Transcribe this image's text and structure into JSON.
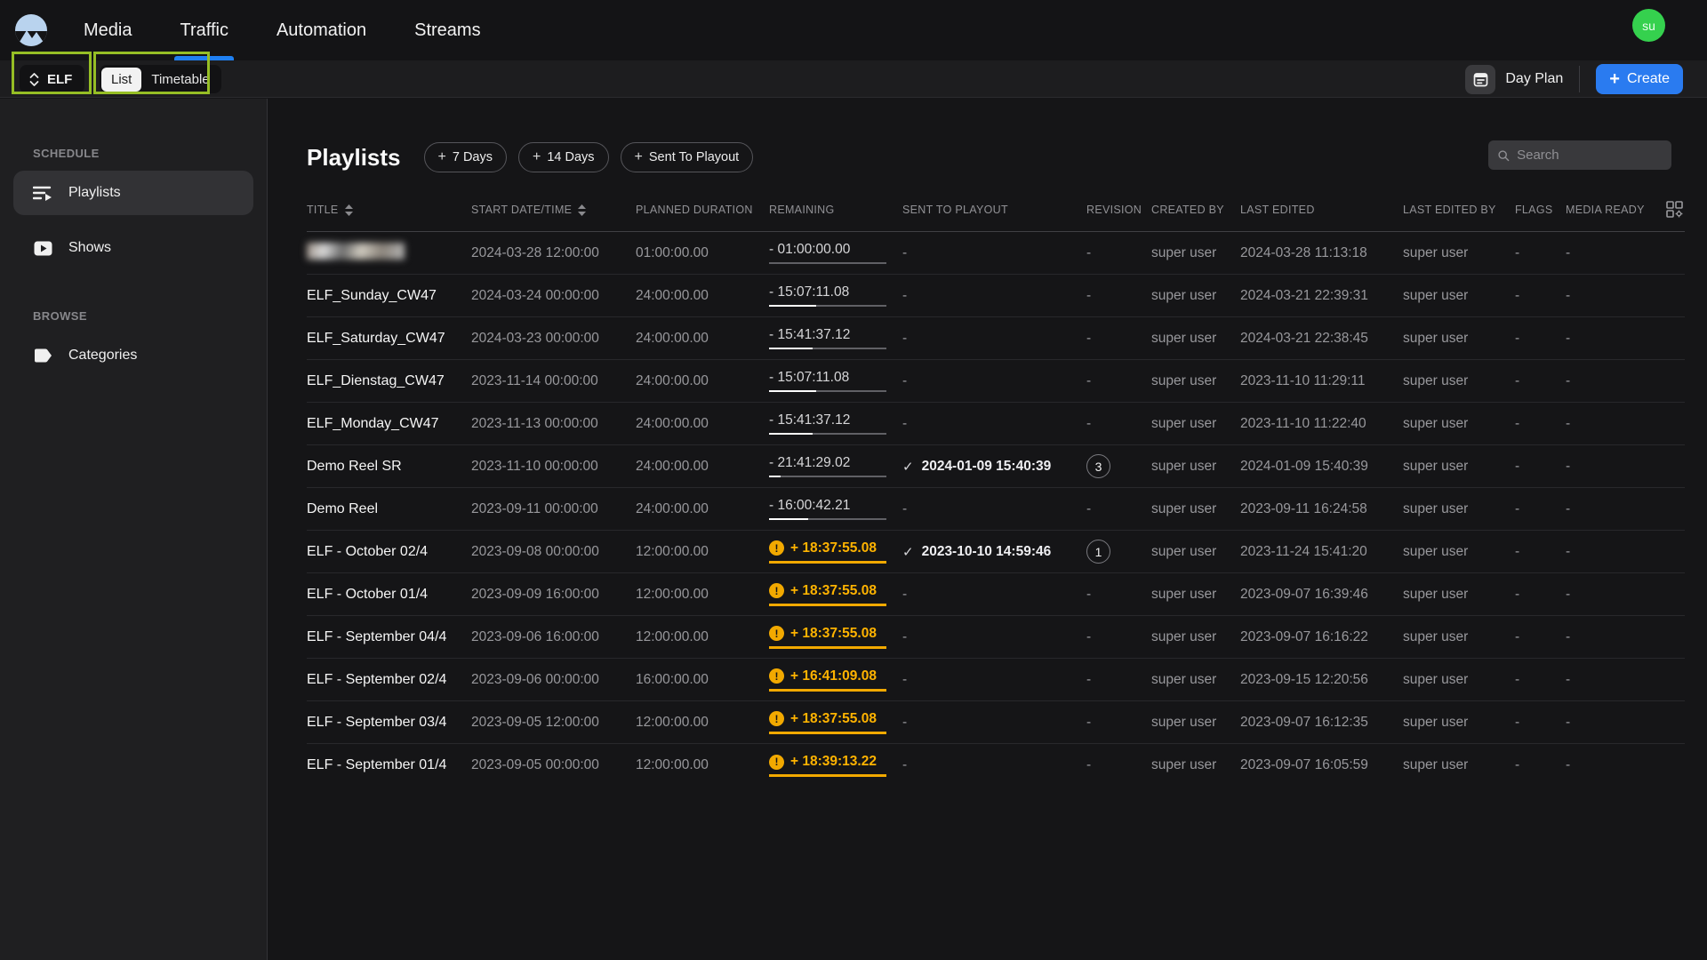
{
  "nav": {
    "items": [
      {
        "label": "Media"
      },
      {
        "label": "Traffic"
      },
      {
        "label": "Automation"
      },
      {
        "label": "Streams"
      }
    ],
    "active": "Traffic",
    "avatar_initials": "su"
  },
  "toolbar": {
    "channel_select": {
      "value": "ELF"
    },
    "view_toggle": {
      "options": [
        "List",
        "Timetable"
      ],
      "active": "List"
    },
    "day_plan_label": "Day Plan",
    "create_label": "Create"
  },
  "sidebar": {
    "schedule_label": "SCHEDULE",
    "browse_label": "BROWSE",
    "playlists_label": "Playlists",
    "shows_label": "Shows",
    "categories_label": "Categories",
    "active_item": "Playlists"
  },
  "main": {
    "title": "Playlists",
    "filters": [
      {
        "label": "7 Days"
      },
      {
        "label": "14 Days"
      },
      {
        "label": "Sent To Playout"
      }
    ],
    "search": {
      "placeholder": "Search",
      "value": ""
    }
  },
  "table": {
    "columns": [
      {
        "label": "TITLE",
        "sortable": true
      },
      {
        "label": "START DATE/TIME",
        "sortable": true
      },
      {
        "label": "PLANNED DURATION",
        "sortable": false
      },
      {
        "label": "REMAINING",
        "sortable": false
      },
      {
        "label": "SENT TO PLAYOUT",
        "sortable": false
      },
      {
        "label": "REVISION",
        "sortable": false
      },
      {
        "label": "CREATED BY",
        "sortable": false
      },
      {
        "label": "LAST EDITED",
        "sortable": false
      },
      {
        "label": "LAST EDITED BY",
        "sortable": false
      },
      {
        "label": "FLAGS",
        "sortable": false
      },
      {
        "label": "MEDIA READY",
        "sortable": false
      }
    ],
    "rows": [
      {
        "title": "",
        "redacted": true,
        "start": "2024-03-28 12:00:00",
        "duration": "01:00:00.00",
        "remaining": {
          "sign": "-",
          "time": "01:00:00.00",
          "warn": false,
          "progress": 0
        },
        "sent": null,
        "revision": null,
        "created_by": "super user",
        "last_edited": "2024-03-28 11:13:18",
        "last_edited_by": "super user",
        "flags": "-",
        "media_ready": "-"
      },
      {
        "title": "ELF_Sunday_CW47",
        "redacted": false,
        "start": "2024-03-24 00:00:00",
        "duration": "24:00:00.00",
        "remaining": {
          "sign": "-",
          "time": "15:07:11.08",
          "warn": false,
          "progress": 40
        },
        "sent": null,
        "revision": null,
        "created_by": "super user",
        "last_edited": "2024-03-21 22:39:31",
        "last_edited_by": "super user",
        "flags": "-",
        "media_ready": "-"
      },
      {
        "title": "ELF_Saturday_CW47",
        "redacted": false,
        "start": "2024-03-23 00:00:00",
        "duration": "24:00:00.00",
        "remaining": {
          "sign": "-",
          "time": "15:41:37.12",
          "warn": false,
          "progress": 37
        },
        "sent": null,
        "revision": null,
        "created_by": "super user",
        "last_edited": "2024-03-21 22:38:45",
        "last_edited_by": "super user",
        "flags": "-",
        "media_ready": "-"
      },
      {
        "title": "ELF_Dienstag_CW47",
        "redacted": false,
        "start": "2023-11-14 00:00:00",
        "duration": "24:00:00.00",
        "remaining": {
          "sign": "-",
          "time": "15:07:11.08",
          "warn": false,
          "progress": 40
        },
        "sent": null,
        "revision": null,
        "created_by": "super user",
        "last_edited": "2023-11-10 11:29:11",
        "last_edited_by": "super user",
        "flags": "-",
        "media_ready": "-"
      },
      {
        "title": "ELF_Monday_CW47",
        "redacted": false,
        "start": "2023-11-13 00:00:00",
        "duration": "24:00:00.00",
        "remaining": {
          "sign": "-",
          "time": "15:41:37.12",
          "warn": false,
          "progress": 37
        },
        "sent": null,
        "revision": null,
        "created_by": "super user",
        "last_edited": "2023-11-10 11:22:40",
        "last_edited_by": "super user",
        "flags": "-",
        "media_ready": "-"
      },
      {
        "title": "Demo Reel SR",
        "redacted": false,
        "start": "2023-11-10 00:00:00",
        "duration": "24:00:00.00",
        "remaining": {
          "sign": "-",
          "time": "21:41:29.02",
          "warn": false,
          "progress": 10
        },
        "sent": "2024-01-09 15:40:39",
        "revision": "3",
        "created_by": "super user",
        "last_edited": "2024-01-09 15:40:39",
        "last_edited_by": "super user",
        "flags": "-",
        "media_ready": "-"
      },
      {
        "title": "Demo Reel",
        "redacted": false,
        "start": "2023-09-11 00:00:00",
        "duration": "24:00:00.00",
        "remaining": {
          "sign": "-",
          "time": "16:00:42.21",
          "warn": false,
          "progress": 33
        },
        "sent": null,
        "revision": null,
        "created_by": "super user",
        "last_edited": "2023-09-11 16:24:58",
        "last_edited_by": "super user",
        "flags": "-",
        "media_ready": "-"
      },
      {
        "title": "ELF - October 02/4",
        "redacted": false,
        "start": "2023-09-08 00:00:00",
        "duration": "12:00:00.00",
        "remaining": {
          "sign": "+",
          "time": "18:37:55.08",
          "warn": true,
          "progress": 100
        },
        "sent": "2023-10-10 14:59:46",
        "revision": "1",
        "created_by": "super user",
        "last_edited": "2023-11-24 15:41:20",
        "last_edited_by": "super user",
        "flags": "-",
        "media_ready": "-"
      },
      {
        "title": "ELF - October 01/4",
        "redacted": false,
        "start": "2023-09-09 16:00:00",
        "duration": "12:00:00.00",
        "remaining": {
          "sign": "+",
          "time": "18:37:55.08",
          "warn": true,
          "progress": 100
        },
        "sent": null,
        "revision": null,
        "created_by": "super user",
        "last_edited": "2023-09-07 16:39:46",
        "last_edited_by": "super user",
        "flags": "-",
        "media_ready": "-"
      },
      {
        "title": "ELF - September 04/4",
        "redacted": false,
        "start": "2023-09-06 16:00:00",
        "duration": "12:00:00.00",
        "remaining": {
          "sign": "+",
          "time": "18:37:55.08",
          "warn": true,
          "progress": 100
        },
        "sent": null,
        "revision": null,
        "created_by": "super user",
        "last_edited": "2023-09-07 16:16:22",
        "last_edited_by": "super user",
        "flags": "-",
        "media_ready": "-"
      },
      {
        "title": "ELF - September 02/4",
        "redacted": false,
        "start": "2023-09-06 00:00:00",
        "duration": "16:00:00.00",
        "remaining": {
          "sign": "+",
          "time": "16:41:09.08",
          "warn": true,
          "progress": 100
        },
        "sent": null,
        "revision": null,
        "created_by": "super user",
        "last_edited": "2023-09-15 12:20:56",
        "last_edited_by": "super user",
        "flags": "-",
        "media_ready": "-"
      },
      {
        "title": "ELF - September 03/4",
        "redacted": false,
        "start": "2023-09-05 12:00:00",
        "duration": "12:00:00.00",
        "remaining": {
          "sign": "+",
          "time": "18:37:55.08",
          "warn": true,
          "progress": 100
        },
        "sent": null,
        "revision": null,
        "created_by": "super user",
        "last_edited": "2023-09-07 16:12:35",
        "last_edited_by": "super user",
        "flags": "-",
        "media_ready": "-"
      },
      {
        "title": "ELF - September 01/4",
        "redacted": false,
        "start": "2023-09-05 00:00:00",
        "duration": "12:00:00.00",
        "remaining": {
          "sign": "+",
          "time": "18:39:13.22",
          "warn": true,
          "progress": 100
        },
        "sent": null,
        "revision": null,
        "created_by": "super user",
        "last_edited": "2023-09-07 16:05:59",
        "last_edited_by": "super user",
        "flags": "-",
        "media_ready": "-"
      }
    ]
  },
  "colors": {
    "accent_blue": "#1f80f2",
    "create_blue": "#2a7bf0",
    "avatar_green": "#35d14e",
    "warning_orange": "#f2a900",
    "warning_text": "#ffb300",
    "annotation_green": "#96be25",
    "background": "#151517",
    "sidebar_background": "#1f1f21"
  }
}
